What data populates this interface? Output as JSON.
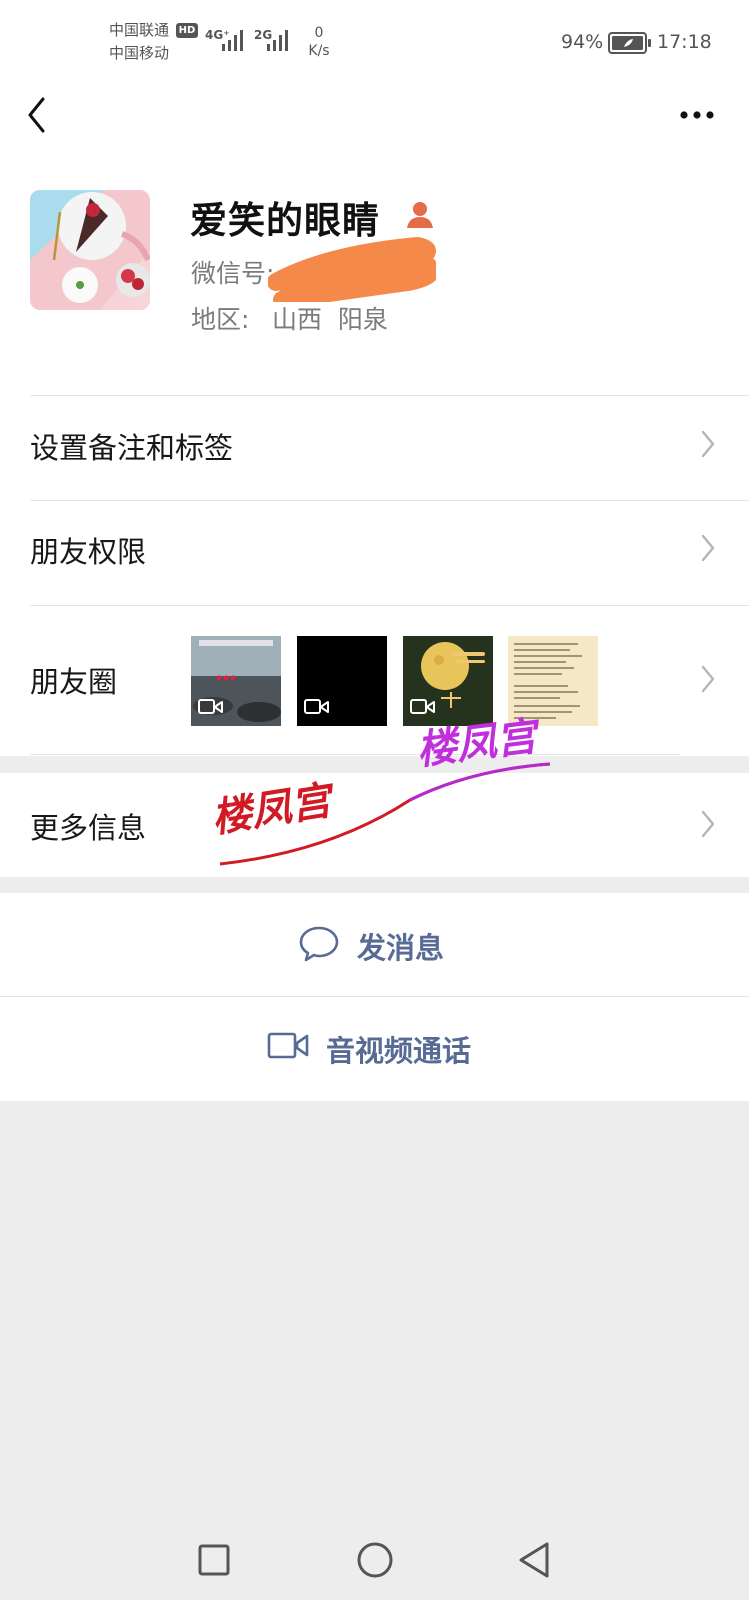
{
  "status_bar": {
    "carrier1": "中国联通",
    "hd": "HD",
    "carrier2": "中国移动",
    "net1": "4G⁺",
    "net2": "2G",
    "speed_value": "0",
    "speed_unit": "K/s",
    "battery_pct": "94%",
    "time": "17:18"
  },
  "nav": {
    "back_icon": "chevron-left-icon",
    "more_icon": "ellipsis-icon"
  },
  "profile": {
    "nickname": "爱笑的眼睛",
    "wechat_id_label": "微信号:",
    "region_label": "地区:",
    "region_value": "山西  阳泉"
  },
  "rows": {
    "remark": "设置备注和标签",
    "permissions": "朋友权限",
    "moments": "朋友圈",
    "more_info": "更多信息"
  },
  "watermark": {
    "text1": "楼凤宫",
    "text2": "楼凤宫"
  },
  "actions": {
    "message": "发消息",
    "video_call": "音视频通话"
  },
  "colors": {
    "link_blue": "#576b95",
    "background": "#ededed",
    "redaction": "#f5894a"
  }
}
